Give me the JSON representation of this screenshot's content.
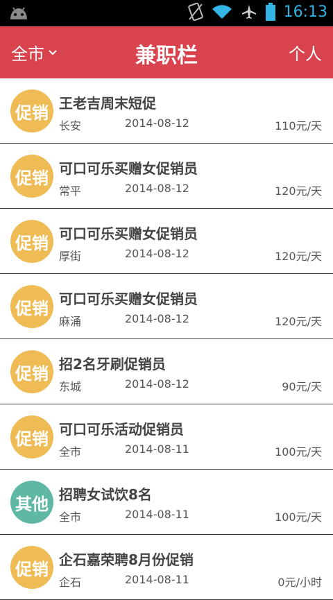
{
  "status_bar": {
    "time": "16:13",
    "icons": [
      "android-icon",
      "no-sim-icon",
      "wifi-icon",
      "airplane-icon",
      "battery-icon"
    ]
  },
  "header": {
    "city": "全市",
    "title": "兼职栏",
    "profile": "个人"
  },
  "colors": {
    "header": "#d9434d",
    "badge_promo": "#efbb55",
    "badge_other": "#5fb8a3"
  },
  "jobs": [
    {
      "badge": "促销",
      "title": "王老吉周末短促",
      "location": "长安",
      "date": "2014-08-12",
      "pay": "110元/天"
    },
    {
      "badge": "促销",
      "title": "可口可乐买赠女促销员",
      "location": "常平",
      "date": "2014-08-12",
      "pay": "120元/天"
    },
    {
      "badge": "促销",
      "title": "可口可乐买赠女促销员",
      "location": "厚街",
      "date": "2014-08-12",
      "pay": "120元/天"
    },
    {
      "badge": "促销",
      "title": "可口可乐买赠女促销员",
      "location": "麻涌",
      "date": "2014-08-12",
      "pay": "120元/天"
    },
    {
      "badge": "促销",
      "title": "招2名牙刷促销员",
      "location": "东城",
      "date": "2014-08-12",
      "pay": "90元/天"
    },
    {
      "badge": "促销",
      "title": "可口可乐活动促销员",
      "location": "全市",
      "date": "2014-08-11",
      "pay": "100元/天"
    },
    {
      "badge": "其他",
      "title": "招聘女试饮8名",
      "location": "全市",
      "date": "2014-08-11",
      "pay": "100元/天"
    },
    {
      "badge": "促销",
      "title": "企石嘉荣聘8月份促销",
      "location": "企石",
      "date": "2014-08-11",
      "pay": "0元/小时"
    }
  ]
}
